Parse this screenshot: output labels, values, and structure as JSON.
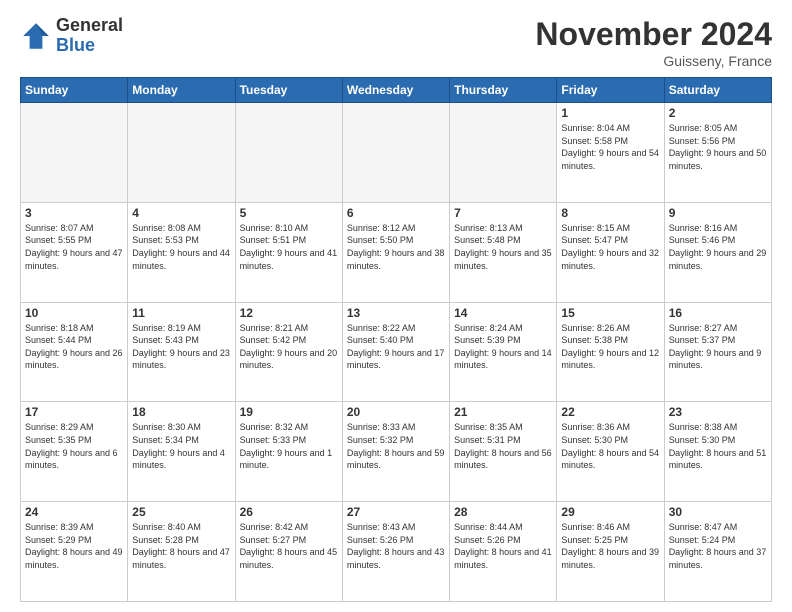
{
  "logo": {
    "general": "General",
    "blue": "Blue"
  },
  "header": {
    "month": "November 2024",
    "location": "Guisseny, France"
  },
  "weekdays": [
    "Sunday",
    "Monday",
    "Tuesday",
    "Wednesday",
    "Thursday",
    "Friday",
    "Saturday"
  ],
  "weeks": [
    [
      {
        "day": "",
        "info": ""
      },
      {
        "day": "",
        "info": ""
      },
      {
        "day": "",
        "info": ""
      },
      {
        "day": "",
        "info": ""
      },
      {
        "day": "",
        "info": ""
      },
      {
        "day": "1",
        "info": "Sunrise: 8:04 AM\nSunset: 5:58 PM\nDaylight: 9 hours and 54 minutes."
      },
      {
        "day": "2",
        "info": "Sunrise: 8:05 AM\nSunset: 5:56 PM\nDaylight: 9 hours and 50 minutes."
      }
    ],
    [
      {
        "day": "3",
        "info": "Sunrise: 8:07 AM\nSunset: 5:55 PM\nDaylight: 9 hours and 47 minutes."
      },
      {
        "day": "4",
        "info": "Sunrise: 8:08 AM\nSunset: 5:53 PM\nDaylight: 9 hours and 44 minutes."
      },
      {
        "day": "5",
        "info": "Sunrise: 8:10 AM\nSunset: 5:51 PM\nDaylight: 9 hours and 41 minutes."
      },
      {
        "day": "6",
        "info": "Sunrise: 8:12 AM\nSunset: 5:50 PM\nDaylight: 9 hours and 38 minutes."
      },
      {
        "day": "7",
        "info": "Sunrise: 8:13 AM\nSunset: 5:48 PM\nDaylight: 9 hours and 35 minutes."
      },
      {
        "day": "8",
        "info": "Sunrise: 8:15 AM\nSunset: 5:47 PM\nDaylight: 9 hours and 32 minutes."
      },
      {
        "day": "9",
        "info": "Sunrise: 8:16 AM\nSunset: 5:46 PM\nDaylight: 9 hours and 29 minutes."
      }
    ],
    [
      {
        "day": "10",
        "info": "Sunrise: 8:18 AM\nSunset: 5:44 PM\nDaylight: 9 hours and 26 minutes."
      },
      {
        "day": "11",
        "info": "Sunrise: 8:19 AM\nSunset: 5:43 PM\nDaylight: 9 hours and 23 minutes."
      },
      {
        "day": "12",
        "info": "Sunrise: 8:21 AM\nSunset: 5:42 PM\nDaylight: 9 hours and 20 minutes."
      },
      {
        "day": "13",
        "info": "Sunrise: 8:22 AM\nSunset: 5:40 PM\nDaylight: 9 hours and 17 minutes."
      },
      {
        "day": "14",
        "info": "Sunrise: 8:24 AM\nSunset: 5:39 PM\nDaylight: 9 hours and 14 minutes."
      },
      {
        "day": "15",
        "info": "Sunrise: 8:26 AM\nSunset: 5:38 PM\nDaylight: 9 hours and 12 minutes."
      },
      {
        "day": "16",
        "info": "Sunrise: 8:27 AM\nSunset: 5:37 PM\nDaylight: 9 hours and 9 minutes."
      }
    ],
    [
      {
        "day": "17",
        "info": "Sunrise: 8:29 AM\nSunset: 5:35 PM\nDaylight: 9 hours and 6 minutes."
      },
      {
        "day": "18",
        "info": "Sunrise: 8:30 AM\nSunset: 5:34 PM\nDaylight: 9 hours and 4 minutes."
      },
      {
        "day": "19",
        "info": "Sunrise: 8:32 AM\nSunset: 5:33 PM\nDaylight: 9 hours and 1 minute."
      },
      {
        "day": "20",
        "info": "Sunrise: 8:33 AM\nSunset: 5:32 PM\nDaylight: 8 hours and 59 minutes."
      },
      {
        "day": "21",
        "info": "Sunrise: 8:35 AM\nSunset: 5:31 PM\nDaylight: 8 hours and 56 minutes."
      },
      {
        "day": "22",
        "info": "Sunrise: 8:36 AM\nSunset: 5:30 PM\nDaylight: 8 hours and 54 minutes."
      },
      {
        "day": "23",
        "info": "Sunrise: 8:38 AM\nSunset: 5:30 PM\nDaylight: 8 hours and 51 minutes."
      }
    ],
    [
      {
        "day": "24",
        "info": "Sunrise: 8:39 AM\nSunset: 5:29 PM\nDaylight: 8 hours and 49 minutes."
      },
      {
        "day": "25",
        "info": "Sunrise: 8:40 AM\nSunset: 5:28 PM\nDaylight: 8 hours and 47 minutes."
      },
      {
        "day": "26",
        "info": "Sunrise: 8:42 AM\nSunset: 5:27 PM\nDaylight: 8 hours and 45 minutes."
      },
      {
        "day": "27",
        "info": "Sunrise: 8:43 AM\nSunset: 5:26 PM\nDaylight: 8 hours and 43 minutes."
      },
      {
        "day": "28",
        "info": "Sunrise: 8:44 AM\nSunset: 5:26 PM\nDaylight: 8 hours and 41 minutes."
      },
      {
        "day": "29",
        "info": "Sunrise: 8:46 AM\nSunset: 5:25 PM\nDaylight: 8 hours and 39 minutes."
      },
      {
        "day": "30",
        "info": "Sunrise: 8:47 AM\nSunset: 5:24 PM\nDaylight: 8 hours and 37 minutes."
      }
    ]
  ]
}
